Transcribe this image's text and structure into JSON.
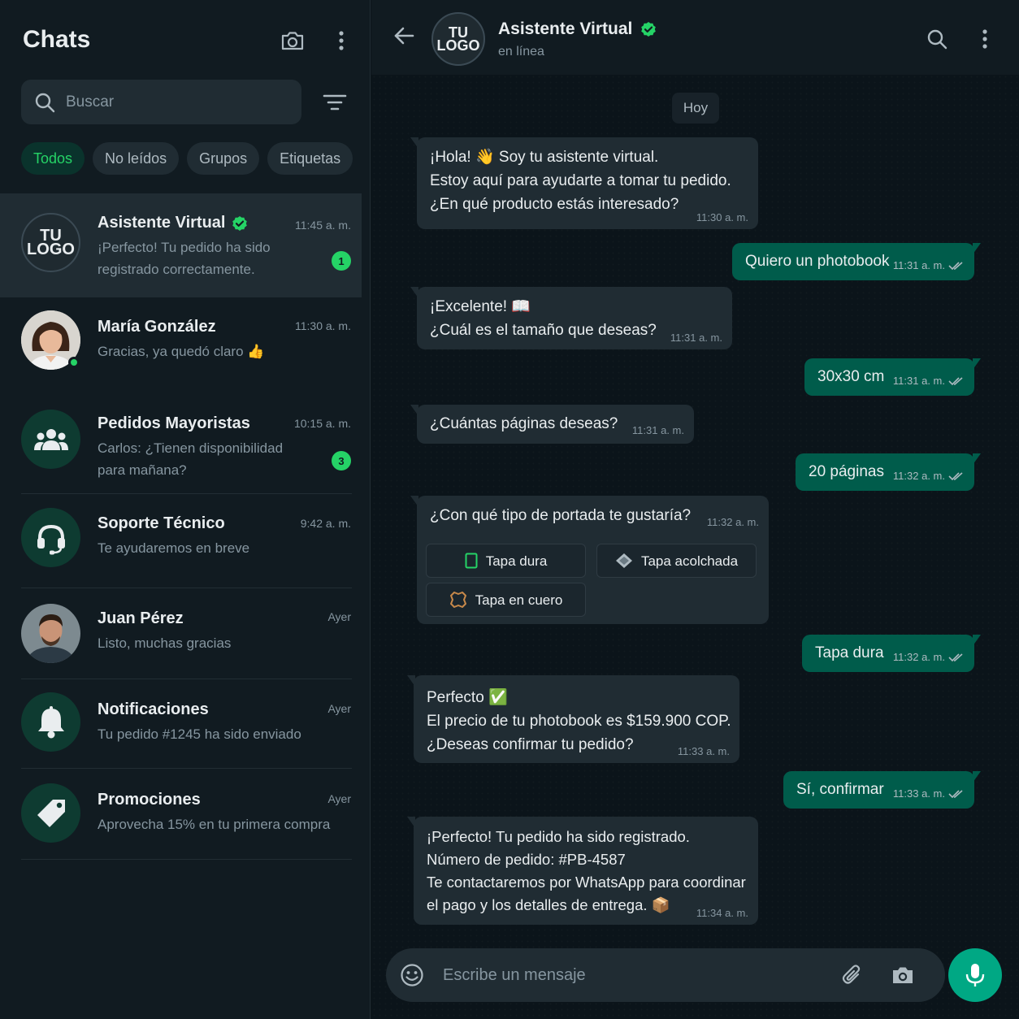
{
  "left": {
    "title": "Chats",
    "search_placeholder": "Buscar",
    "filters": [
      "Todos",
      "No leídos",
      "Grupos",
      "Etiquetas"
    ]
  },
  "chats": [
    {
      "name": "Asistente Virtual",
      "time": "11:45 a. m.",
      "preview": "¡Perfecto! Tu pedido ha sido registrado correctamente.",
      "badge": "1",
      "verified": true,
      "avatar_text": [
        "TU",
        "LOGO"
      ]
    },
    {
      "name": "María González",
      "time": "11:30 a. m.",
      "preview": "Gracias, ya quedó claro 👍"
    },
    {
      "name": "Pedidos Mayoristas",
      "time": "10:15 a. m.",
      "preview": "Carlos: ¿Tienen disponibilidad para mañana?",
      "badge": "3",
      "icon": "group-icon"
    },
    {
      "name": "Soporte Técnico",
      "time": "9:42 a. m.",
      "preview": "Te ayudaremos en breve",
      "icon": "headset-icon"
    },
    {
      "name": "Juan Pérez",
      "time": "Ayer",
      "preview": "Listo, muchas gracias"
    },
    {
      "name": "Notificaciones",
      "time": "Ayer",
      "preview": "Tu pedido #1245 ha sido enviado",
      "icon": "bell-icon"
    },
    {
      "name": "Promociones",
      "time": "Ayer",
      "preview": "Aprovecha 15% en tu primera compra",
      "icon": "tag-icon"
    }
  ],
  "conversation": {
    "name": "Asistente Virtual",
    "status": "en línea",
    "avatar_text": [
      "TU",
      "LOGO"
    ],
    "day": "Hoy",
    "messages": [
      {
        "dir": "in",
        "lines": [
          "¡Hola! 👋 Soy tu asistente virtual.",
          "Estoy aquí para ayudarte a tomar tu pedido.",
          "¿En qué producto estás interesado?"
        ],
        "time": "11:30 a. m."
      },
      {
        "dir": "out",
        "lines": [
          "Quiero un photobook"
        ],
        "time": "11:31 a. m."
      },
      {
        "dir": "in",
        "lines": [
          "¡Excelente! 📖",
          "¿Cuál es el tamaño que deseas?"
        ],
        "time": "11:31 a. m."
      },
      {
        "dir": "out",
        "lines": [
          "30x30 cm"
        ],
        "time": "11:31 a. m."
      },
      {
        "dir": "in",
        "lines": [
          "¿Cuántas páginas deseas?"
        ],
        "time": "11:31 a. m."
      },
      {
        "dir": "out",
        "lines": [
          "20 páginas"
        ],
        "time": "11:32 a. m."
      },
      {
        "dir": "in",
        "lines": [
          "¿Con qué tipo de portada te gustaría?"
        ],
        "time": "11:32 a. m."
      },
      {
        "dir": "out",
        "lines": [
          "Tapa dura"
        ],
        "time": "11:32 a. m."
      },
      {
        "dir": "in",
        "lines": [
          "Perfecto ✅",
          "El precio de tu photobook es $159.900 COP.",
          "¿Deseas confirmar tu pedido?"
        ],
        "time": "11:33 a. m."
      },
      {
        "dir": "out",
        "lines": [
          "Sí, confirmar"
        ],
        "time": "11:33 a. m."
      },
      {
        "dir": "in",
        "lines": [
          "¡Perfecto! Tu pedido ha sido registrado.",
          "Número de pedido: #PB-4587",
          "Te contactaremos por WhatsApp para coordinar",
          "el pago y los detalles de entrega. 📦"
        ],
        "time": "11:34 a. m."
      }
    ],
    "cover_options": [
      "Tapa dura",
      "Tapa acolchada",
      "Tapa en cuero"
    ]
  },
  "composer": {
    "placeholder": "Escribe un mensaje"
  },
  "colors": {
    "accent": "#25d366",
    "outgoing_bubble": "#005c4b",
    "incoming_bubble": "#202c33",
    "panel": "#111b21"
  }
}
